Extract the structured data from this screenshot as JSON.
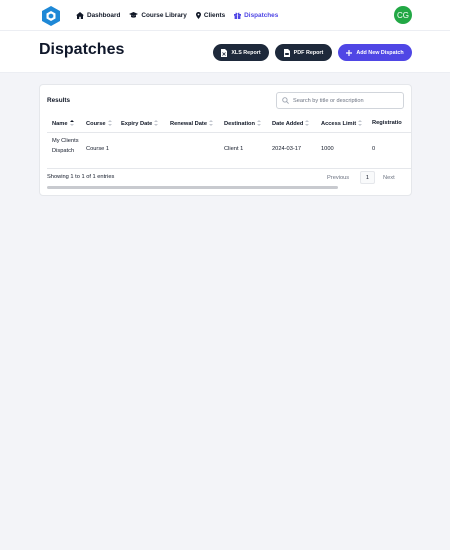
{
  "nav": {
    "items": [
      {
        "label": "Dashboard",
        "icon": "home-icon"
      },
      {
        "label": "Course Library",
        "icon": "graduation-cap-icon"
      },
      {
        "label": "Clients",
        "icon": "map-pin-icon"
      },
      {
        "label": "Dispatches",
        "icon": "gift-icon",
        "active": true
      }
    ],
    "avatar_initials": "CG"
  },
  "page": {
    "title": "Dispatches",
    "buttons": {
      "xls": "XLS Report",
      "pdf": "PDF Report",
      "add": "Add New Dispatch"
    }
  },
  "results": {
    "label": "Results",
    "search_placeholder": "Search by title or description",
    "columns": [
      "Name",
      "Course",
      "Expiry Date",
      "Renewal Date",
      "Destination",
      "Date Added",
      "Access Limit",
      "Registratio"
    ],
    "rows": [
      {
        "name": "My Clients Dispatch",
        "course": "Course 1",
        "expiry_date": "",
        "renewal_date": "",
        "destination": "Client 1",
        "date_added": "2024-03-17",
        "access_limit": "1000",
        "registrations": "0"
      }
    ],
    "info": "Showing 1 to 1 of 1 entries",
    "pagination": {
      "previous": "Previous",
      "page": "1",
      "next": "Next"
    }
  },
  "colors": {
    "accent": "#4f46e5",
    "dark_button": "#1e293b",
    "avatar": "#22a845",
    "logo": "#1e88d6"
  }
}
